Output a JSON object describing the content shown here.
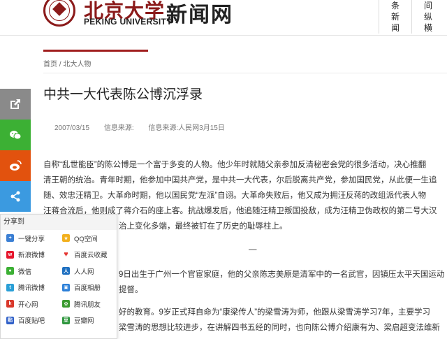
{
  "header": {
    "brand_cn": "北京大学",
    "brand_en": "PEKING UNIVERSITY",
    "site_title": "新闻网",
    "nav": [
      {
        "lines": [
          "",
          "条",
          "新",
          "闻"
        ]
      },
      {
        "lines": [
          "间",
          "纵",
          "横"
        ]
      }
    ]
  },
  "breadcrumb": {
    "home": "首页",
    "separator": " / ",
    "section": "北大人物"
  },
  "article": {
    "title": "中共一大代表陈公博沉浮录",
    "date": "2007/03/15",
    "source_label": "信息来源:",
    "source_value": "信息来源:人民网3月15日",
    "paragraphs": [
      "自称“乱世能臣”的陈公博是一个富于多变的人物。他少年时就随父亲参加反清秘密会党的很多活动，决心推翻",
      "清王朝的统治。青年时期，他参加中国共产党，是中共一大代表，尔后脱离共产党，参加国民党，从此便一生追",
      "随、效忠汪精卫。大革命时期，他以国民党“左派”自诩。大革命失败后，他又成为拥汪反蒋的改组派代表人物",
      "汪蒋合流后，他则成了蒋介石的座上客。抗战爆发后，他追随汪精卫叛国投敌，成为汪精卫伪政权的第二号大汉",
      "治上变化多端，最终被钉在了历史的耻辱柱上。",
      "—",
      "9日出生于广州一个官宦家庭，他的父亲陈志美原是清军中的一名武官，因镇压太平天国运动",
      "提督。",
      "好的教育。9岁正式拜自命为“康梁传人”的梁雪涛为师，他跟从梁雪涛学习7年，主要学习",
      "梁雪涛的思想比较进步，在讲解四书五经的同时，也向陈公博介绍康有为、梁启超变法维新"
    ]
  },
  "share_panel": {
    "heading": "分享到",
    "items": [
      {
        "label": "一键分享",
        "color": "#3b7fd4",
        "icon": "plus-icon"
      },
      {
        "label": "QQ空间",
        "color": "#f2b01e",
        "icon": "star-icon"
      },
      {
        "label": "新浪微博",
        "color": "#e6162d",
        "icon": "weibo-icon"
      },
      {
        "label": "百度云收藏",
        "color": "#e53935",
        "icon": "heart-icon"
      },
      {
        "label": "微信",
        "color": "#3cb034",
        "icon": "wechat-icon"
      },
      {
        "label": "人人网",
        "color": "#1e6fc0",
        "icon": "renren-icon"
      },
      {
        "label": "腾讯微博",
        "color": "#2a9fd6",
        "icon": "tencent-weibo-icon"
      },
      {
        "label": "百度相册",
        "color": "#2b7fd8",
        "icon": "album-icon"
      },
      {
        "label": "开心网",
        "color": "#d9382b",
        "icon": "kaixin-icon"
      },
      {
        "label": "腾讯朋友",
        "color": "#3a9a2e",
        "icon": "friends-icon"
      },
      {
        "label": "百度贴吧",
        "color": "#3060c8",
        "icon": "tieba-icon"
      },
      {
        "label": "豆瓣网",
        "color": "#2e963d",
        "icon": "douban-icon"
      }
    ]
  },
  "colors": {
    "accent": "#a01e1e",
    "share_gray": "#8a8a8a",
    "share_wechat": "#3cb034",
    "share_weibo": "#e2520e",
    "share_generic": "#3b9ae0"
  }
}
